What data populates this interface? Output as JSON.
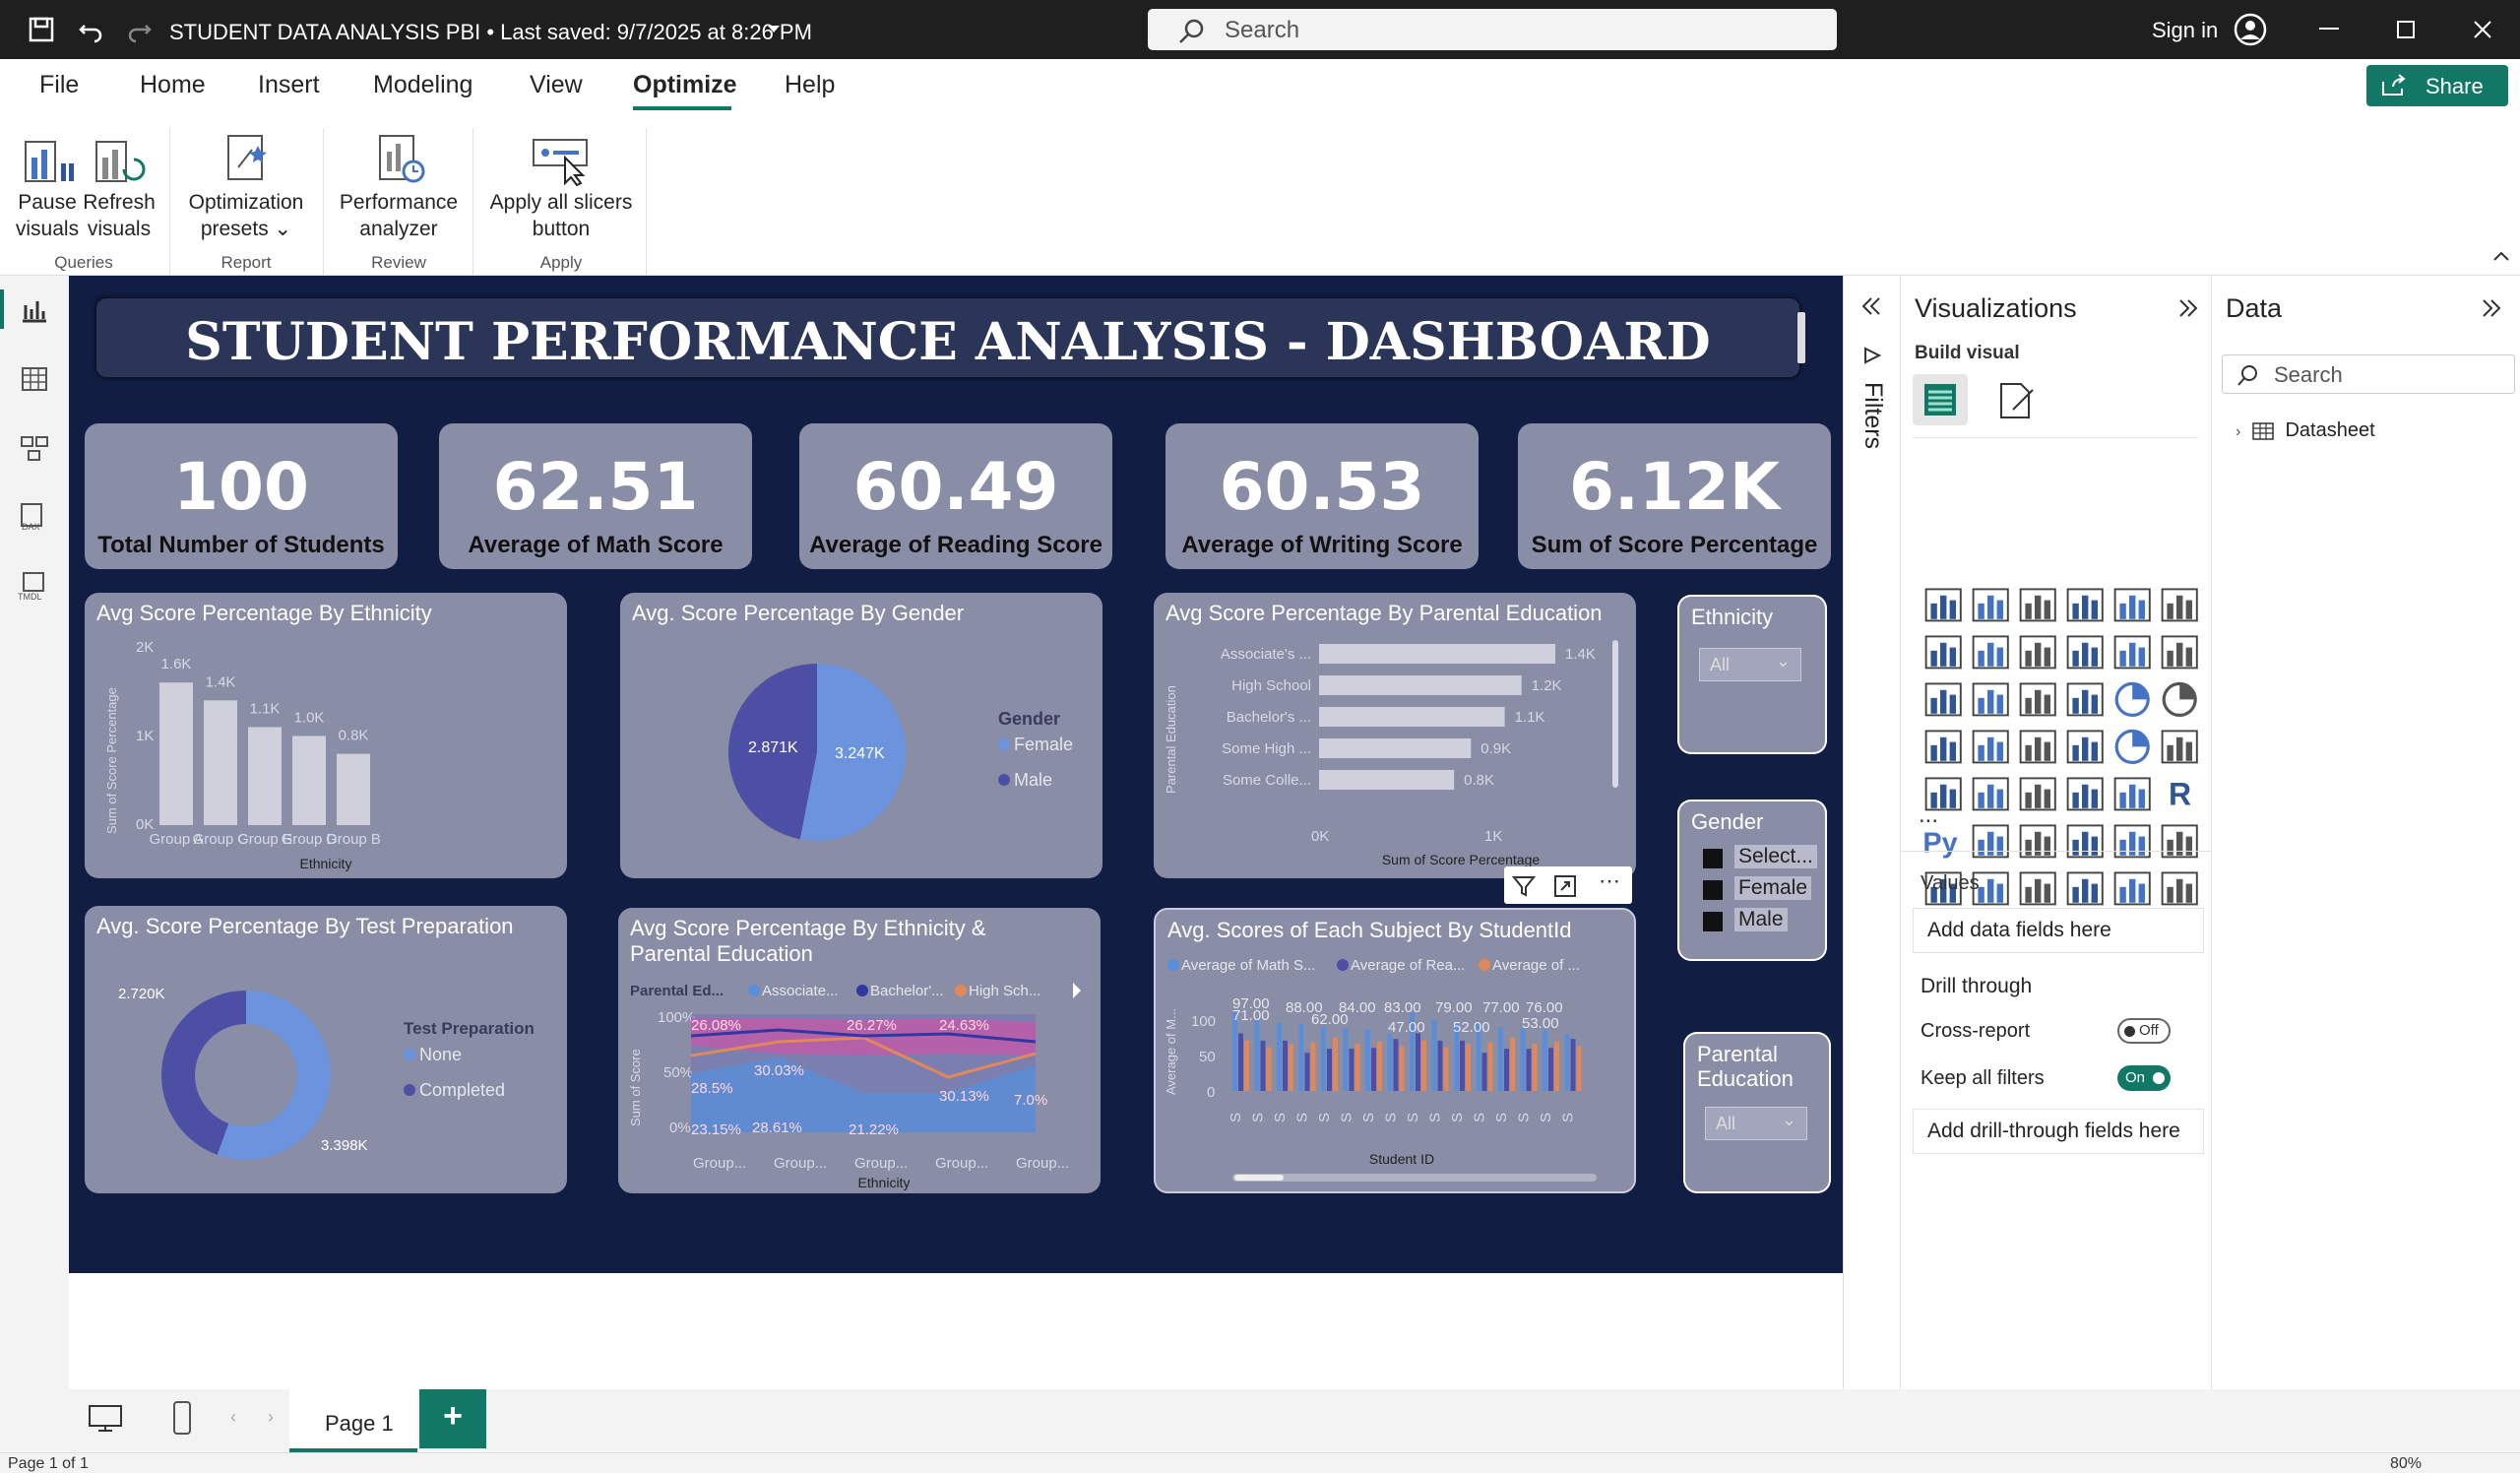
{
  "titlebar": {
    "title": "STUDENT DATA ANALYSIS PBI • Last saved: 9/7/2025 at 8:26 PM",
    "search_placeholder": "Search",
    "signin": "Sign in"
  },
  "menu": {
    "items": [
      "File",
      "Home",
      "Insert",
      "Modeling",
      "View",
      "Optimize",
      "Help"
    ],
    "active": "Optimize",
    "share": "Share"
  },
  "ribbon": {
    "pause": "Pause",
    "pause2": "visuals",
    "refresh": "Refresh",
    "refresh2": "visuals",
    "group_queries": "Queries",
    "opt": "Optimization",
    "opt2": "presets",
    "group_report": "Report",
    "perf": "Performance",
    "perf2": "analyzer",
    "group_review": "Review",
    "apply": "Apply all slicers",
    "apply2": "button",
    "group_apply": "Apply"
  },
  "dashboard": {
    "title": "STUDENT PERFORMANCE ANALYSIS - DASHBOARD",
    "kpis": [
      {
        "value": "100",
        "label": "Total Number of Students"
      },
      {
        "value": "62.51",
        "label": "Average of Math Score"
      },
      {
        "value": "60.49",
        "label": "Average of Reading Score"
      },
      {
        "value": "60.53",
        "label": "Average of Writing Score"
      },
      {
        "value": "6.12K",
        "label": "Sum of Score Percentage"
      }
    ],
    "slicers": {
      "ethnicity": {
        "title": "Ethnicity",
        "value": "All"
      },
      "gender": {
        "title": "Gender",
        "options": [
          "Select...",
          "Female",
          "Male"
        ]
      },
      "parental": {
        "title1": "Parental",
        "title2": "Education",
        "value": "All"
      }
    }
  },
  "chart_data": [
    {
      "type": "bar",
      "title": "Avg Score Percentage By Ethnicity",
      "xlabel": "Ethnicity",
      "ylabel": "Sum of Score Percentage",
      "categories": [
        "Group A",
        "Group C",
        "Group E",
        "Group D",
        "Group B"
      ],
      "values": [
        1600,
        1400,
        1100,
        1000,
        800
      ],
      "value_labels": [
        "1.6K",
        "1.4K",
        "1.1K",
        "1.0K",
        "0.8K"
      ],
      "y_ticks": [
        "2K",
        "1K",
        "0K"
      ],
      "ylim": [
        0,
        2000
      ]
    },
    {
      "type": "pie",
      "title": "Avg. Score Percentage By Gender",
      "legend_title": "Gender",
      "labels": [
        "Female",
        "Male"
      ],
      "values": [
        3247,
        2871
      ],
      "value_labels": [
        "3.247K",
        "2.871K"
      ],
      "colors": [
        "#6c93dd",
        "#4d4fa4"
      ]
    },
    {
      "type": "bar",
      "title": "Avg Score Percentage By Parental Education",
      "orientation": "horizontal",
      "ylabel": "Parental Education",
      "xlabel": "Sum of Score Percentage",
      "categories": [
        "Associate's ...",
        "High School",
        "Bachelor's ...",
        "Some High ...",
        "Some Colle..."
      ],
      "values": [
        1400,
        1200,
        1100,
        900,
        800
      ],
      "value_labels": [
        "1.4K",
        "1.2K",
        "1.1K",
        "0.9K",
        "0.8K"
      ],
      "x_ticks": [
        "0K",
        "1K"
      ],
      "xlim": [
        0,
        1400
      ]
    },
    {
      "type": "pie",
      "title": "Avg. Score Percentage By Test Preparation",
      "donut": true,
      "legend_title": "Test Preparation",
      "labels": [
        "None",
        "Completed"
      ],
      "values": [
        3398,
        2720
      ],
      "value_labels": [
        "3.398K",
        "2.720K"
      ],
      "colors": [
        "#6c93dd",
        "#4d4fa4"
      ]
    },
    {
      "type": "area",
      "title1": "Avg Score Percentage By Ethnicity &",
      "title2": "Parental Education",
      "legend_title": "Parental Ed...",
      "legend": [
        "Associate...",
        "Bachelor'...",
        "High Sch..."
      ],
      "xlabel": "Ethnicity",
      "ylabel": "Sum of Score",
      "categories": [
        "Group...",
        "Group...",
        "Group...",
        "Group...",
        "Group..."
      ],
      "y_ticks": [
        "100%",
        "50%",
        "0%"
      ],
      "annotations": [
        "26.08%",
        "26.27%",
        "24.63%",
        "30.03%",
        "30.13%",
        "28.5%",
        "23.15%",
        "28.61%",
        "21.22%",
        "7.0%"
      ]
    },
    {
      "type": "bar",
      "title": "Avg. Scores of Each Subject By StudentId",
      "xlabel": "Student ID",
      "ylabel": "Average of M...",
      "legend": [
        "Average of Math S...",
        "Average of Rea...",
        "Average of ..."
      ],
      "colors": [
        "#5b8ed8",
        "#4e4ea8",
        "#e0885a"
      ],
      "categories": [
        "S",
        "S",
        "S",
        "S",
        "S",
        "S",
        "S",
        "S",
        "S",
        "S",
        "S",
        "S",
        "S",
        "S",
        "S",
        "S"
      ],
      "value_labels": [
        "97.00",
        "71.00",
        "88.00",
        "62.00",
        "84.00",
        "83.00",
        "47.00",
        "79.00",
        "52.00",
        "77.00",
        "76.00",
        "53.00"
      ],
      "y_ticks": [
        "100",
        "50",
        "0"
      ],
      "ylim": [
        0,
        110
      ]
    }
  ],
  "filters_label": "Filters",
  "viz": {
    "title": "Visualizations",
    "build": "Build visual",
    "values": "Values",
    "add_fields": "Add data fields here",
    "drill": "Drill through",
    "cross": "Cross-report",
    "cross_state": "Off",
    "keep": "Keep all filters",
    "keep_state": "On",
    "add_drill": "Add drill-through fields here",
    "more": "..."
  },
  "data_pane": {
    "title": "Data",
    "search": "Search",
    "item": "Datasheet"
  },
  "tabs": {
    "page": "Page 1",
    "add": "+"
  },
  "status": {
    "left": "Page 1 of 1",
    "zoom": "80%"
  }
}
